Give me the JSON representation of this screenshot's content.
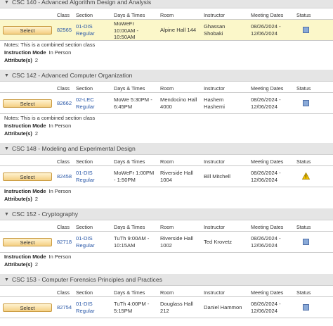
{
  "headers": {
    "class": "Class",
    "section": "Section",
    "days_times": "Days & Times",
    "room": "Room",
    "instructor": "Instructor",
    "meeting_dates": "Meeting Dates",
    "status": "Status"
  },
  "select_label": "Select",
  "labels": {
    "instruction_mode": "Instruction Mode",
    "attributes": "Attribute(s)"
  },
  "colors": {
    "selected_row": "#fbf7c9",
    "link": "#2a58a8",
    "status_open": "#8aaad8",
    "status_warning": "#f2c200"
  },
  "courses": [
    {
      "title": "CSC 140 - Advanced Algorithm Design and Analysis",
      "class_nbr": "82565",
      "section": [
        "01-DIS",
        "Regular"
      ],
      "days_times": [
        "MoWeFr",
        "10:00AM -",
        "10:50AM"
      ],
      "room": [
        "Alpine Hall 144"
      ],
      "instructor": [
        "Ghassan",
        "Shobaki"
      ],
      "dates": [
        "08/26/2024 -",
        "12/06/2024"
      ],
      "status": "open-square-icon",
      "selected": true,
      "notes": "Notes: This is a combined section class",
      "instruction_mode": "In Person",
      "attributes": "2"
    },
    {
      "title": "CSC 142 - Advanced Computer Organization",
      "class_nbr": "82662",
      "section": [
        "02-LEC",
        "Regular"
      ],
      "days_times": [
        "MoWe 5:30PM -",
        "6:45PM"
      ],
      "room": [
        "Mendocino Hall",
        "4000"
      ],
      "instructor": [
        "Hashem",
        "Hashemi"
      ],
      "dates": [
        "08/26/2024 -",
        "12/06/2024"
      ],
      "status": "open-square-icon",
      "selected": false,
      "notes": "Notes: This is a combined section class",
      "instruction_mode": "In Person",
      "attributes": "2"
    },
    {
      "title": "CSC 148 - Modeling and Experimental Design",
      "class_nbr": "82458",
      "section": [
        "01-DIS",
        "Regular"
      ],
      "days_times": [
        "MoWeFr 1:00PM",
        "- 1:50PM"
      ],
      "room": [
        "Riverside Hall",
        "1004"
      ],
      "instructor": [
        "Bill Mitchell"
      ],
      "dates": [
        "08/26/2024 -",
        "12/06/2024"
      ],
      "status": "warning-triangle-icon",
      "selected": false,
      "notes": "",
      "instruction_mode": "In Person",
      "attributes": "2"
    },
    {
      "title": "CSC 152 - Cryptography",
      "class_nbr": "82718",
      "section": [
        "01-DIS",
        "Regular"
      ],
      "days_times": [
        "TuTh 9:00AM -",
        "10:15AM"
      ],
      "room": [
        "Riverside Hall",
        "1002"
      ],
      "instructor": [
        "Ted Krovetz"
      ],
      "dates": [
        "08/26/2024 -",
        "12/06/2024"
      ],
      "status": "open-square-icon",
      "selected": false,
      "notes": "",
      "instruction_mode": "In Person",
      "attributes": "2"
    },
    {
      "title": "CSC 153 - Computer Forensics Principles and Practices",
      "class_nbr": "82754",
      "section": [
        "01-DIS",
        "Regular"
      ],
      "days_times": [
        "TuTh 4:00PM -",
        "5:15PM"
      ],
      "room": [
        "Douglass Hall",
        "212"
      ],
      "instructor": [
        "Daniel Hammon"
      ],
      "dates": [
        "08/26/2024 -",
        "12/06/2024"
      ],
      "status": "open-square-icon",
      "selected": false,
      "notes": "",
      "instruction_mode": "",
      "attributes": ""
    }
  ]
}
